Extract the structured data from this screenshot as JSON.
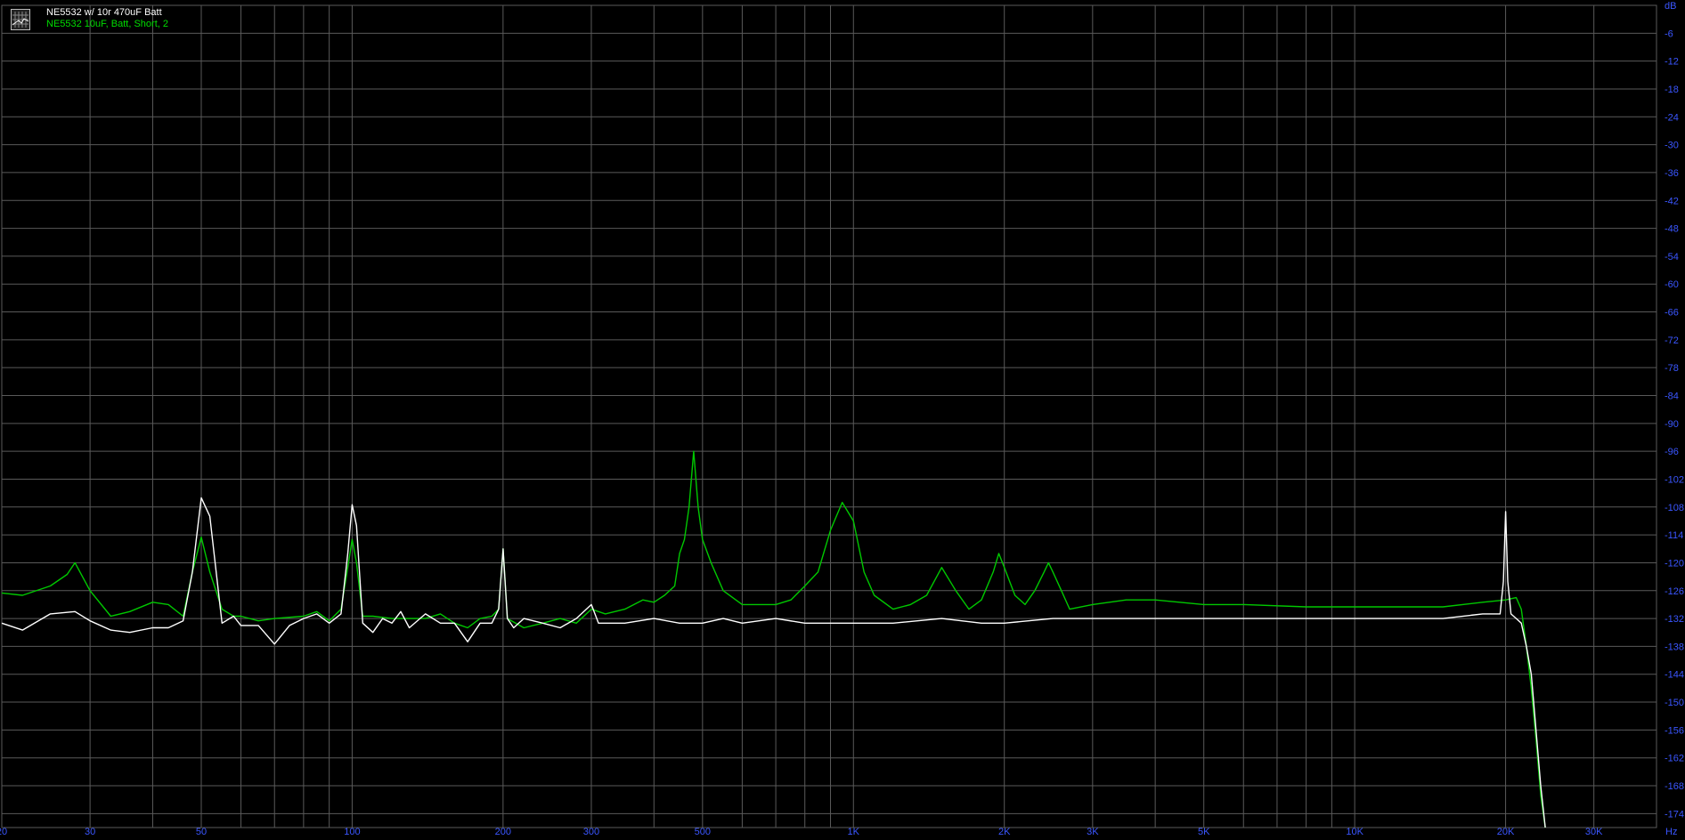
{
  "chart_data": {
    "type": "line",
    "title": "",
    "xlabel": "",
    "ylabel": "",
    "x_unit": "Hz",
    "y_unit": "dB",
    "x_scale": "log",
    "xlim": [
      20,
      40000
    ],
    "ylim": [
      -177,
      0
    ],
    "grid": true,
    "legend_position": "top-left",
    "background": "#000000",
    "grid_color": "#5a5a5a",
    "tick_label_color": "#3a56ff",
    "x_ticks": [
      {
        "value": 20,
        "label": "20"
      },
      {
        "value": 30,
        "label": "30"
      },
      {
        "value": 50,
        "label": "50"
      },
      {
        "value": 100,
        "label": "100"
      },
      {
        "value": 200,
        "label": "200"
      },
      {
        "value": 300,
        "label": "300"
      },
      {
        "value": 500,
        "label": "500"
      },
      {
        "value": 1000,
        "label": "1K"
      },
      {
        "value": 2000,
        "label": "2K"
      },
      {
        "value": 3000,
        "label": "3K"
      },
      {
        "value": 5000,
        "label": "5K"
      },
      {
        "value": 10000,
        "label": "10K"
      },
      {
        "value": 20000,
        "label": "20K"
      },
      {
        "value": 30000,
        "label": "30K"
      }
    ],
    "y_ticks": [
      {
        "value": 0,
        "label": "dB"
      },
      {
        "value": -6,
        "label": "-6"
      },
      {
        "value": -12,
        "label": "-12"
      },
      {
        "value": -18,
        "label": "-18"
      },
      {
        "value": -24,
        "label": "-24"
      },
      {
        "value": -30,
        "label": "-30"
      },
      {
        "value": -36,
        "label": "-36"
      },
      {
        "value": -42,
        "label": "-42"
      },
      {
        "value": -48,
        "label": "-48"
      },
      {
        "value": -54,
        "label": "-54"
      },
      {
        "value": -60,
        "label": "-60"
      },
      {
        "value": -66,
        "label": "-66"
      },
      {
        "value": -72,
        "label": "-72"
      },
      {
        "value": -78,
        "label": "-78"
      },
      {
        "value": -84,
        "label": "-84"
      },
      {
        "value": -90,
        "label": "-90"
      },
      {
        "value": -96,
        "label": "-96"
      },
      {
        "value": -102,
        "label": "-102"
      },
      {
        "value": -108,
        "label": "-108"
      },
      {
        "value": -114,
        "label": "-114"
      },
      {
        "value": -120,
        "label": "-120"
      },
      {
        "value": -126,
        "label": "-126"
      },
      {
        "value": -132,
        "label": "-132"
      },
      {
        "value": -138,
        "label": "-138"
      },
      {
        "value": -144,
        "label": "-144"
      },
      {
        "value": -150,
        "label": "-150"
      },
      {
        "value": -156,
        "label": "-156"
      },
      {
        "value": -162,
        "label": "-162"
      },
      {
        "value": -168,
        "label": "-168"
      },
      {
        "value": -174,
        "label": "-174"
      }
    ],
    "series": [
      {
        "name": "NE5532 w/ 10r 470uF Batt",
        "color": "#ffffff",
        "points": [
          [
            20,
            -133
          ],
          [
            22,
            -134.5
          ],
          [
            25,
            -131
          ],
          [
            28,
            -130.5
          ],
          [
            30,
            -132.5
          ],
          [
            33,
            -134.5
          ],
          [
            36,
            -135
          ],
          [
            40,
            -134
          ],
          [
            43,
            -134
          ],
          [
            46,
            -132.5
          ],
          [
            48,
            -122
          ],
          [
            50,
            -106
          ],
          [
            52,
            -110
          ],
          [
            55,
            -133
          ],
          [
            58,
            -131.5
          ],
          [
            60,
            -133.5
          ],
          [
            65,
            -133.5
          ],
          [
            70,
            -137.5
          ],
          [
            75,
            -133.5
          ],
          [
            80,
            -132
          ],
          [
            85,
            -131
          ],
          [
            90,
            -133
          ],
          [
            95,
            -131
          ],
          [
            98,
            -118
          ],
          [
            100,
            -107.5
          ],
          [
            102,
            -112
          ],
          [
            105,
            -133
          ],
          [
            110,
            -135
          ],
          [
            115,
            -132
          ],
          [
            120,
            -133
          ],
          [
            125,
            -130.5
          ],
          [
            130,
            -134
          ],
          [
            140,
            -131
          ],
          [
            150,
            -133
          ],
          [
            160,
            -133
          ],
          [
            170,
            -137
          ],
          [
            180,
            -133
          ],
          [
            190,
            -133
          ],
          [
            196,
            -130
          ],
          [
            200,
            -117
          ],
          [
            204,
            -132
          ],
          [
            210,
            -134
          ],
          [
            220,
            -132
          ],
          [
            240,
            -133
          ],
          [
            260,
            -134
          ],
          [
            280,
            -132
          ],
          [
            300,
            -129
          ],
          [
            310,
            -133
          ],
          [
            350,
            -133
          ],
          [
            400,
            -132
          ],
          [
            450,
            -133
          ],
          [
            500,
            -133
          ],
          [
            550,
            -132
          ],
          [
            600,
            -133
          ],
          [
            700,
            -132
          ],
          [
            800,
            -133
          ],
          [
            900,
            -133
          ],
          [
            1000,
            -133
          ],
          [
            1200,
            -133
          ],
          [
            1500,
            -132
          ],
          [
            1800,
            -133
          ],
          [
            2000,
            -133
          ],
          [
            2500,
            -132
          ],
          [
            3000,
            -132
          ],
          [
            4000,
            -132
          ],
          [
            5000,
            -132
          ],
          [
            7000,
            -132
          ],
          [
            10000,
            -132
          ],
          [
            13000,
            -132
          ],
          [
            15000,
            -132
          ],
          [
            18000,
            -131
          ],
          [
            19500,
            -131
          ],
          [
            19800,
            -124
          ],
          [
            20000,
            -109
          ],
          [
            20200,
            -124
          ],
          [
            20500,
            -131
          ],
          [
            21000,
            -132
          ],
          [
            21500,
            -133
          ],
          [
            22000,
            -138
          ],
          [
            22500,
            -144
          ],
          [
            23000,
            -156
          ],
          [
            23500,
            -168
          ],
          [
            24000,
            -177
          ]
        ]
      },
      {
        "name": "NE5532 10uF, Batt, Short, 2",
        "color": "#00c800",
        "points": [
          [
            20,
            -126.5
          ],
          [
            22,
            -127
          ],
          [
            25,
            -125
          ],
          [
            27,
            -122.5
          ],
          [
            28,
            -120
          ],
          [
            30,
            -126
          ],
          [
            33,
            -131.5
          ],
          [
            36,
            -130.5
          ],
          [
            40,
            -128.5
          ],
          [
            43,
            -129
          ],
          [
            46,
            -131.5
          ],
          [
            48,
            -122
          ],
          [
            50,
            -114.5
          ],
          [
            52,
            -122
          ],
          [
            55,
            -130
          ],
          [
            58,
            -131.5
          ],
          [
            60,
            -131.5
          ],
          [
            65,
            -132.5
          ],
          [
            70,
            -132
          ],
          [
            80,
            -131.5
          ],
          [
            85,
            -130.5
          ],
          [
            90,
            -132.5
          ],
          [
            95,
            -130
          ],
          [
            98,
            -121
          ],
          [
            100,
            -115
          ],
          [
            102,
            -120
          ],
          [
            105,
            -131.5
          ],
          [
            110,
            -131.5
          ],
          [
            120,
            -132
          ],
          [
            130,
            -132
          ],
          [
            140,
            -132
          ],
          [
            150,
            -131
          ],
          [
            160,
            -133
          ],
          [
            170,
            -134
          ],
          [
            180,
            -132
          ],
          [
            190,
            -131.5
          ],
          [
            196,
            -130
          ],
          [
            200,
            -117
          ],
          [
            204,
            -132
          ],
          [
            220,
            -134
          ],
          [
            240,
            -133
          ],
          [
            260,
            -132
          ],
          [
            280,
            -133
          ],
          [
            300,
            -130
          ],
          [
            320,
            -131
          ],
          [
            350,
            -130
          ],
          [
            380,
            -128
          ],
          [
            400,
            -128.5
          ],
          [
            420,
            -127
          ],
          [
            440,
            -125
          ],
          [
            450,
            -118
          ],
          [
            460,
            -115
          ],
          [
            470,
            -108
          ],
          [
            480,
            -96
          ],
          [
            490,
            -108
          ],
          [
            500,
            -115
          ],
          [
            520,
            -120
          ],
          [
            550,
            -126
          ],
          [
            600,
            -129
          ],
          [
            650,
            -129
          ],
          [
            700,
            -129
          ],
          [
            750,
            -128
          ],
          [
            800,
            -125
          ],
          [
            850,
            -122
          ],
          [
            900,
            -113
          ],
          [
            950,
            -107
          ],
          [
            1000,
            -111
          ],
          [
            1050,
            -122
          ],
          [
            1100,
            -127
          ],
          [
            1200,
            -130
          ],
          [
            1300,
            -129
          ],
          [
            1400,
            -127
          ],
          [
            1500,
            -121
          ],
          [
            1600,
            -126
          ],
          [
            1700,
            -130
          ],
          [
            1800,
            -128
          ],
          [
            1900,
            -122
          ],
          [
            1950,
            -118
          ],
          [
            2000,
            -121
          ],
          [
            2100,
            -127
          ],
          [
            2200,
            -129
          ],
          [
            2300,
            -126
          ],
          [
            2400,
            -122
          ],
          [
            2450,
            -120
          ],
          [
            2500,
            -122
          ],
          [
            2600,
            -126
          ],
          [
            2700,
            -130
          ],
          [
            3000,
            -129
          ],
          [
            3500,
            -128
          ],
          [
            4000,
            -128
          ],
          [
            5000,
            -129
          ],
          [
            6000,
            -129
          ],
          [
            8000,
            -129.5
          ],
          [
            10000,
            -129.5
          ],
          [
            12000,
            -129.5
          ],
          [
            15000,
            -129.5
          ],
          [
            18000,
            -128.5
          ],
          [
            20000,
            -128
          ],
          [
            21000,
            -127.5
          ],
          [
            21500,
            -130
          ],
          [
            22000,
            -138
          ],
          [
            22500,
            -147
          ],
          [
            23000,
            -158
          ],
          [
            23500,
            -170
          ],
          [
            24000,
            -177
          ]
        ]
      }
    ]
  }
}
